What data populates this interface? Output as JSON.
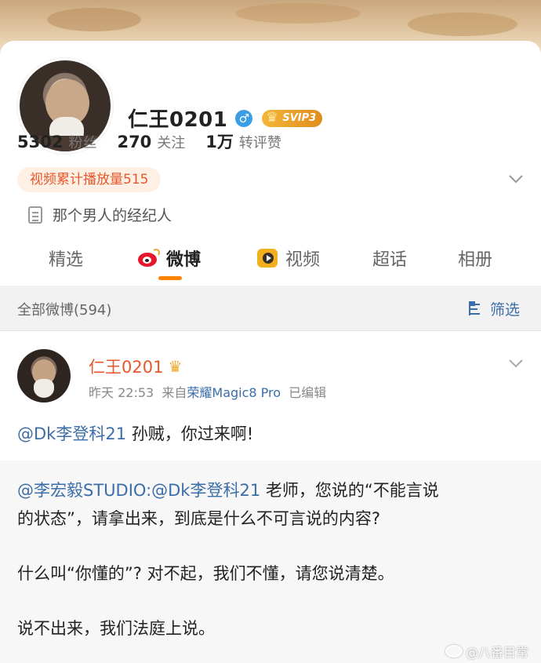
{
  "profile": {
    "name": "仁王0201",
    "gender_symbol": "♂",
    "vip_badge": "SVIP3",
    "stats": [
      {
        "value": "5302",
        "label": "粉丝"
      },
      {
        "value": "270",
        "label": "关注"
      },
      {
        "value": "1万",
        "label": "转评赞"
      }
    ],
    "video_tag": "视频累计播放量515",
    "bio": "那个男人的经纪人"
  },
  "tabs": [
    {
      "label": "精选"
    },
    {
      "label": "微博"
    },
    {
      "label": "视频"
    },
    {
      "label": "超话"
    },
    {
      "label": "相册"
    }
  ],
  "filter": {
    "all_label": "全部微博(594)",
    "filter_label": "筛选"
  },
  "post": {
    "author": "仁王0201",
    "time": "昨天 22:53",
    "from_prefix": "来自",
    "source": "荣耀Magic8 Pro",
    "edited": "已编辑",
    "mention": "@Dk李登科21",
    "text": " 孙贼，你过来啊!",
    "repost": {
      "mention_1": "@李宏毅STUDIO",
      "colon": ":",
      "mention_2": "@Dk李登科21",
      "line1_rest": " 老师，您说的“不能言说",
      "line2": "的状态”，请拿出来，到底是什么不可言说的内容?",
      "line3": "什么叫“你懂的”? 对不起，我们不懂，请您说清楚。",
      "line4": "说不出来，我们法庭上说。"
    }
  },
  "watermark": "@八番目常",
  "colors": {
    "accent_orange": "#ff8200",
    "link_blue": "#3b6ea8",
    "name_orange": "#e8572a"
  }
}
